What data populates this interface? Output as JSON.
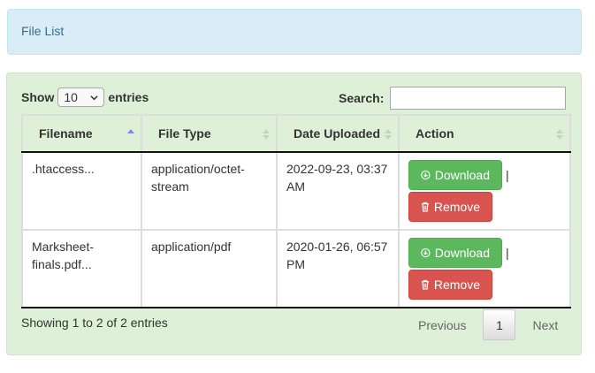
{
  "alert": {
    "text": "File List"
  },
  "length_menu": {
    "prefix": "Show",
    "value": "10",
    "suffix": "entries"
  },
  "search": {
    "label": "Search:",
    "value": ""
  },
  "table": {
    "headers": [
      "Filename",
      "File Type",
      "Date Uploaded",
      "Action"
    ],
    "sort": {
      "column": "Filename",
      "direction": "asc"
    },
    "rows": [
      {
        "filename": ".htaccess...",
        "type": "application/octet-stream",
        "date": "2022-09-23, 03:37 AM"
      },
      {
        "filename": "Marksheet-finals.pdf...",
        "type": "application/pdf",
        "date": "2020-01-26, 06:57 PM"
      }
    ],
    "download_label": "Download",
    "remove_label": "Remove",
    "separator": "|"
  },
  "info": "Showing 1 to 2 of 2 entries",
  "pagination": {
    "previous": "Previous",
    "current": "1",
    "next": "Next"
  },
  "colors": {
    "alert_bg": "#d9edf7",
    "panel_bg": "#dff0d8",
    "download": "#5cb85c",
    "remove": "#d9534f",
    "sort_active": "#7b8de8"
  }
}
